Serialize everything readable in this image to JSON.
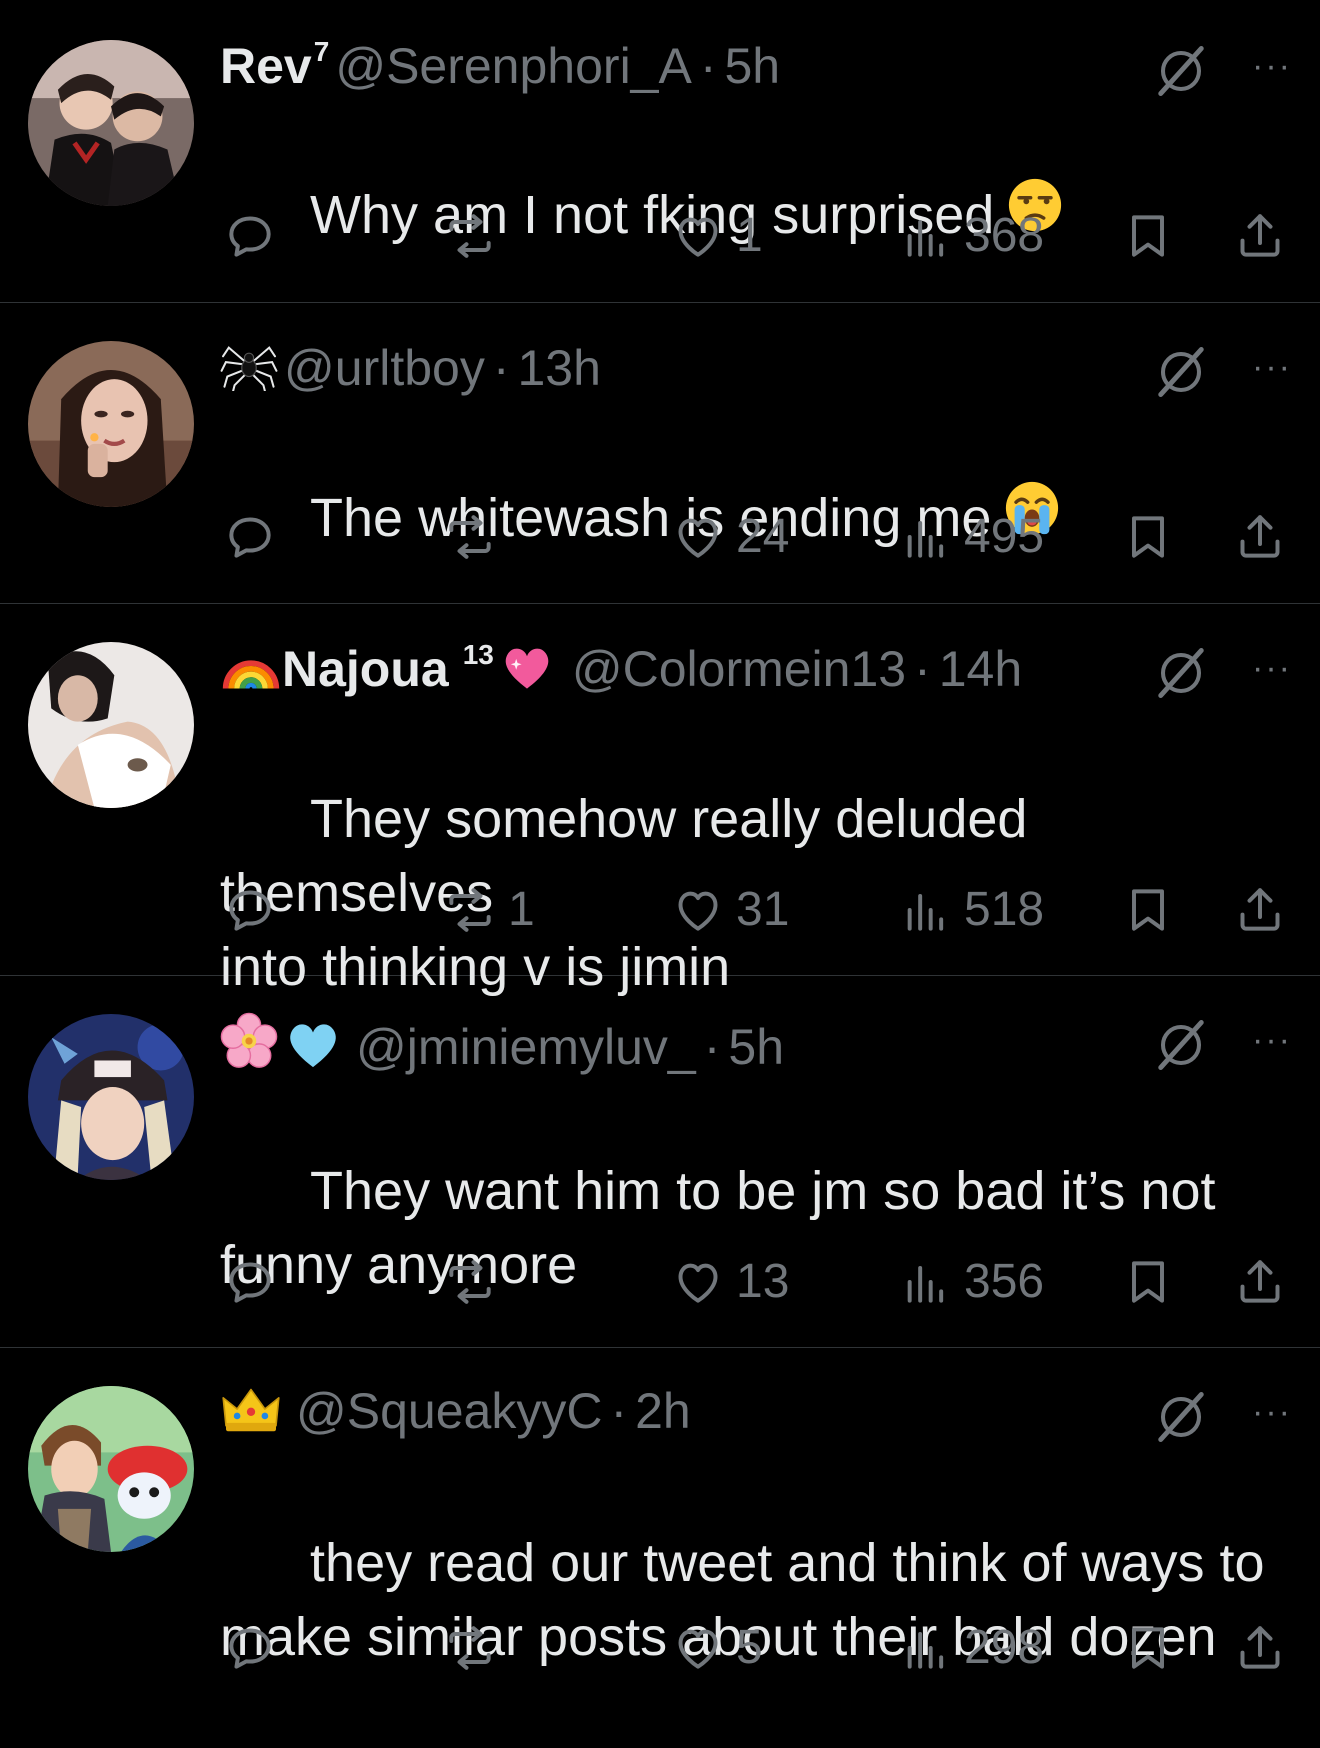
{
  "colors": {
    "background": "#000000",
    "text": "#e7e9ea",
    "muted": "#71767b",
    "divider": "#2f3336"
  },
  "tweets": [
    {
      "name": "Rev",
      "name_sup": "7",
      "name_emoji": [],
      "handle": "@Serenphori_A",
      "dot": "·",
      "time": "5h",
      "text": "Why am I not fking surprised",
      "text_emoji": "unamused-face",
      "replies": "",
      "reposts": "",
      "likes": "1",
      "views": "368",
      "more_label": "···"
    },
    {
      "name": "",
      "name_sup": "",
      "name_emoji": [
        "spider"
      ],
      "handle": "@urltboy",
      "dot": "·",
      "time": "13h",
      "text": "The whitewash is ending me",
      "text_emoji": "loudly-crying-face",
      "replies": "",
      "reposts": "",
      "likes": "24",
      "views": "495",
      "more_label": "···"
    },
    {
      "name": "Najoua",
      "name_sup": "13",
      "name_emoji": [
        "rainbow",
        "sparkling-heart"
      ],
      "handle": "@Colormein13",
      "dot": "·",
      "time": "14h",
      "text": "They somehow really deluded themselves\ninto thinking v is jimin",
      "text_emoji": "",
      "replies": "",
      "reposts": "1",
      "likes": "31",
      "views": "518",
      "more_label": "···"
    },
    {
      "name": "",
      "name_sup": "",
      "name_emoji": [
        "cherry-blossom",
        "light-blue-heart"
      ],
      "handle": "@jminiemyluv_",
      "dot": "·",
      "time": "5h",
      "text": "They want him to be jm so bad it’s not\nfunny anymore",
      "text_emoji": "",
      "replies": "",
      "reposts": "",
      "likes": "13",
      "views": "356",
      "more_label": "···"
    },
    {
      "name": "",
      "name_sup": "",
      "name_emoji": [
        "crown"
      ],
      "handle": "@SqueakyyC",
      "dot": "·",
      "time": "2h",
      "text": "they read our tweet and think of ways to\nmake similar posts about their bald dozen",
      "text_emoji": "",
      "replies": "",
      "reposts": "",
      "likes": "5",
      "views": "298",
      "more_label": "···"
    }
  ]
}
